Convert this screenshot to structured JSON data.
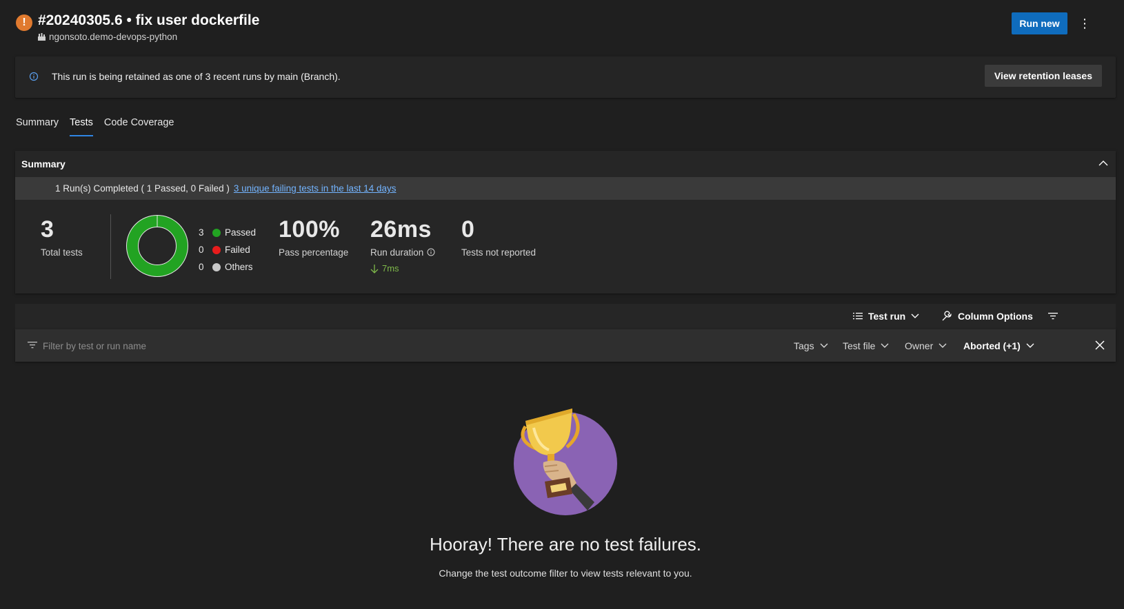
{
  "header": {
    "status_glyph": "!",
    "title": "#20240305.6 • fix user dockerfile",
    "repo": "ngonsoto.demo-devops-python",
    "run_new_label": "Run new",
    "more_glyph": "⋮"
  },
  "banner": {
    "text": "This run is being retained as one of 3 recent runs by main (Branch).",
    "button_label": "View retention leases"
  },
  "tabs": [
    {
      "label": "Summary",
      "active": false
    },
    {
      "label": "Tests",
      "active": true
    },
    {
      "label": "Code Coverage",
      "active": false
    }
  ],
  "summary": {
    "title": "Summary",
    "runs_text": "1 Run(s) Completed ( 1 Passed, 0 Failed )",
    "runs_link": "3 unique failing tests in the last 14 days",
    "total_tests": "3",
    "total_label": "Total tests",
    "legend": [
      {
        "count": "3",
        "label": "Passed",
        "color": "#22a322"
      },
      {
        "count": "0",
        "label": "Failed",
        "color": "#e81c1c"
      },
      {
        "count": "0",
        "label": "Others",
        "color": "#c8c8c8"
      }
    ],
    "pass_pct": "100%",
    "pass_label": "Pass percentage",
    "duration": "26ms",
    "duration_label": "Run duration",
    "duration_delta": "7ms",
    "not_reported": "0",
    "not_reported_label": "Tests not reported"
  },
  "results": {
    "group_by_label": "Test run",
    "column_options_label": "Column Options",
    "filter_placeholder": "Filter by test or run name",
    "filters": {
      "tags": "Tags",
      "test_file": "Test file",
      "owner": "Owner",
      "outcome": "Aborted (+1)"
    },
    "empty_title": "Hooray! There are no test failures.",
    "empty_subtitle": "Change the test outcome filter to view tests relevant to you."
  },
  "colors": {
    "accent": "#0f6cbd",
    "status_warning": "#e07a2f",
    "passed": "#22a322",
    "delta_good": "#7fba4a",
    "link": "#73b4ff"
  },
  "icons": [
    "warning-icon",
    "repo-icon",
    "more-icon",
    "info-icon",
    "chevron-up-icon",
    "list-icon",
    "chevron-down-icon",
    "wrench-icon",
    "filter-icon",
    "close-icon",
    "arrow-down-icon",
    "trophy-illustration"
  ]
}
